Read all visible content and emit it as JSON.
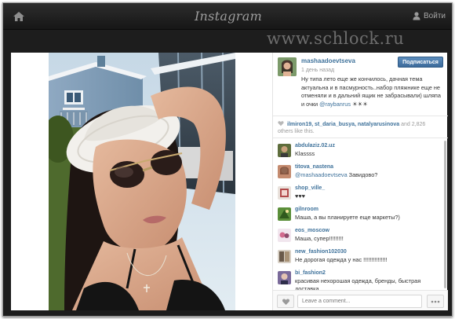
{
  "topbar": {
    "brand": "Instagram",
    "login_label": "Войти",
    "home_icon": "home-icon",
    "user_icon": "user-icon"
  },
  "watermark": "www.schlock.ru",
  "post": {
    "username": "mashaadoevtseva",
    "follow_label": "Подписаться",
    "time_ago": "1 день назад",
    "caption_text": "Ну типа лето еще же кончилось, дачная тема актуальна и в пасмурность..набор пляжнике еще не отменяли и в дальний ящик не забрасывали) шляпа и очки ",
    "caption_tag": "@raybanrus",
    "caption_emoji": "☀☀☀"
  },
  "likes": {
    "users": "ilmiron19, st_daria_busya, natalyarusinova",
    "and_label": "and 2,826",
    "others_label": "others like this."
  },
  "comments": [
    {
      "user": "abdulaziz.02.uz",
      "text": "Klassss",
      "mention": ""
    },
    {
      "user": "titova_nastena",
      "text": " Завидово?",
      "mention": "@mashaadoevtseva"
    },
    {
      "user": "shop_ville_",
      "text": "♥♥♥",
      "mention": ""
    },
    {
      "user": "gilnroom",
      "text": "Маша, а вы планируете еще маркеты?)",
      "mention": ""
    },
    {
      "user": "eos_moscow",
      "text": "Маша, супер!!!!!!!!!",
      "mention": ""
    },
    {
      "user": "new_fashion102030",
      "text": "Не дорогая одежда у нас !!!!!!!!!!!!!!!",
      "mention": ""
    },
    {
      "user": "bi_fashion2",
      "text": "красивая нехорошая одежда, бренды, быстрая доставка",
      "mention": ""
    }
  ],
  "footer": {
    "comment_placeholder": "Leave a comment...",
    "more_icon": "ellipsis-icon",
    "like_icon": "heart-icon"
  },
  "colors": {
    "link_blue": "#3f729b",
    "follow_button": "#4a7aac",
    "topbar_dark": "#1d1d1d"
  }
}
